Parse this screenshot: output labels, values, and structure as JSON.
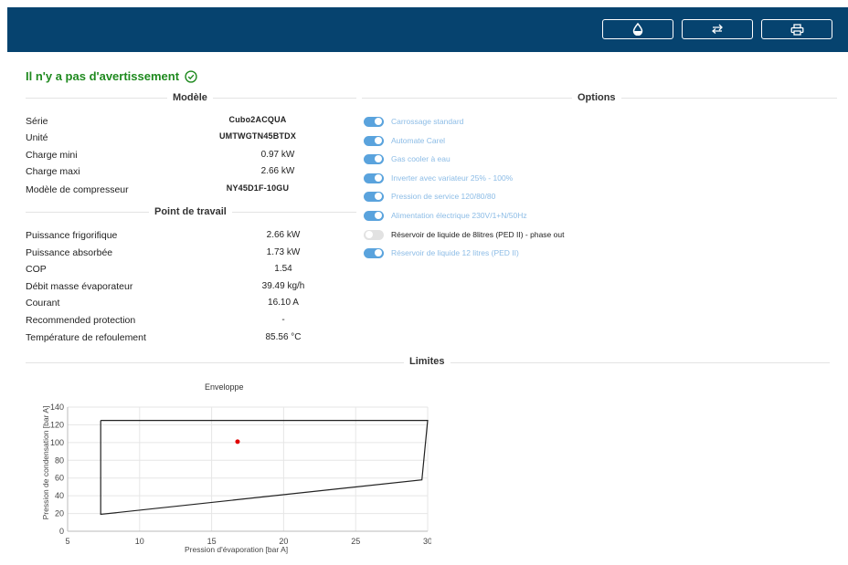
{
  "toolbar": {
    "buttons": [
      {
        "icon": "water-drop-icon"
      },
      {
        "icon": "swap-arrows-icon"
      },
      {
        "icon": "printer-icon"
      }
    ],
    "background": "#06436f"
  },
  "status": {
    "message": "Il n'y a pas d'avertissement",
    "color": "#1f8a1f",
    "icon": "check-circle-icon"
  },
  "model": {
    "title": "Modèle",
    "rows": [
      {
        "label": "Série",
        "value": "Cubo2ACQUA"
      },
      {
        "label": "Unité",
        "value": "UMTWGTN45BTDX"
      },
      {
        "label": "Charge mini",
        "value": "0.97 kW"
      },
      {
        "label": "Charge maxi",
        "value": "2.66 kW"
      },
      {
        "label": "Modèle de compresseur",
        "value": "NY45D1F-10GU"
      }
    ]
  },
  "work_point": {
    "title": "Point de travail",
    "rows": [
      {
        "label": "Puissance frigorifique",
        "value": "2.66 kW"
      },
      {
        "label": "Puissance absorbée",
        "value": "1.73 kW"
      },
      {
        "label": "COP",
        "value": "1.54"
      },
      {
        "label": "Débit masse évaporateur",
        "value": "39.49 kg/h"
      },
      {
        "label": "Courant",
        "value": "16.10 A"
      },
      {
        "label": "Recommended protection",
        "value": "-"
      },
      {
        "label": "Température de refoulement",
        "value": "85.56 °C"
      }
    ]
  },
  "options": {
    "title": "Options",
    "items": [
      {
        "label": "Carrossage standard",
        "enabled": true
      },
      {
        "label": "Automate Carel",
        "enabled": true
      },
      {
        "label": "Gas cooler à eau",
        "enabled": true
      },
      {
        "label": "Inverter avec variateur 25% - 100%",
        "enabled": true
      },
      {
        "label": "Pression de service 120/80/80",
        "enabled": true
      },
      {
        "label": "Alimentation électrique 230V/1+N/50Hz",
        "enabled": true
      },
      {
        "label": "Réservoir de liquide de 8litres (PED II) - phase out",
        "enabled": false
      },
      {
        "label": "Réservoir de liquide 12 litres (PED II)",
        "enabled": true
      }
    ],
    "on_color": "#5aa3dd"
  },
  "limits": {
    "title": "Limites"
  },
  "chart_data": {
    "type": "scatter",
    "title": "Enveloppe",
    "xlabel": "Pression d'évaporation [bar A]",
    "ylabel": "Pression de condensation [bar A]",
    "xlim": [
      5,
      30
    ],
    "ylim": [
      0,
      140
    ],
    "xticks": [
      5,
      10,
      15,
      20,
      25,
      30
    ],
    "yticks": [
      0,
      20,
      40,
      60,
      80,
      100,
      120,
      140
    ],
    "grid": true,
    "series": [
      {
        "kind": "envelope",
        "color": "#222222",
        "points": [
          [
            7.3,
            125
          ],
          [
            30,
            125
          ],
          [
            29.6,
            58
          ],
          [
            7.3,
            19
          ],
          [
            7.3,
            125
          ]
        ]
      },
      {
        "kind": "operating-point",
        "color": "#e00000",
        "points": [
          [
            16.8,
            101
          ]
        ]
      }
    ]
  }
}
